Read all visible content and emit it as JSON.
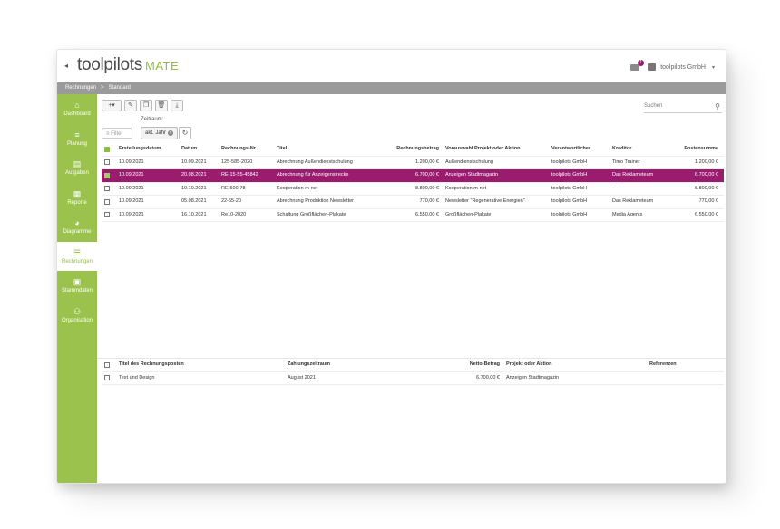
{
  "app": {
    "logo_main": "toolpilots",
    "logo_suffix": "MATE",
    "back_glyph": "◂"
  },
  "header": {
    "mail_badge": "1",
    "account": "toolpilots GmbH",
    "caret": "▾"
  },
  "breadcrumb": {
    "items": [
      "Rechnungen",
      "Standard"
    ],
    "separator": ">"
  },
  "sidebar": {
    "items": [
      {
        "label": "Dashboard",
        "icon": "home-icon",
        "glyph": "⌂"
      },
      {
        "label": "Planung",
        "icon": "planning-icon",
        "glyph": "≡"
      },
      {
        "label": "Aufgaben",
        "icon": "tasks-icon",
        "glyph": "▤"
      },
      {
        "label": "Reporte",
        "icon": "report-icon",
        "glyph": "▦"
      },
      {
        "label": "Diagramme",
        "icon": "pie-chart-icon",
        "glyph": "◕"
      },
      {
        "label": "Rechnungen",
        "icon": "invoice-icon",
        "glyph": "☰",
        "active": true
      },
      {
        "label": "Stammdaten",
        "icon": "image-icon",
        "glyph": "▣"
      },
      {
        "label": "Organisation",
        "icon": "organisation-icon",
        "glyph": "⚇"
      }
    ]
  },
  "toolbar": {
    "add": "+▾",
    "edit": "✎",
    "copy": "❐",
    "delete": "🗑",
    "download": "⤓"
  },
  "filter": {
    "placeholder": "Filter",
    "zeitraum_label": "Zeitraum:",
    "chip": "akt. Jahr",
    "chip_remove": "×",
    "refresh": "↻"
  },
  "search": {
    "placeholder": "Suchen",
    "glyph": "⚲"
  },
  "invoices": {
    "headers": [
      "Erstellungsdatum",
      "Datum",
      "Rechnungs-Nr.",
      "Titel",
      "Rechnungsbetrag",
      "Vorauswahl Projekt oder Aktion",
      "Verantwortlicher",
      "Kreditor",
      "Postensumme"
    ],
    "rows": [
      [
        "10.09.2021",
        "10.09.2021",
        "125-585-2020",
        "Abrechnung Außendienstschulung",
        "1.200,00 €",
        "Außendienstschulung",
        "toolpilots GmbH",
        "Timo Trainer",
        "1.200,00 €"
      ],
      [
        "10.09.2021",
        "20.08.2021",
        "RE-15-55-45842",
        "Abrechnung für Anzeigenstrecke",
        "6.700,00 €",
        "Anzeigen Stadtmagazin",
        "toolpilots GmbH",
        "Das Reklameteam",
        "6.700,00 €"
      ],
      [
        "10.09.2021",
        "10.10.2021",
        "RE-500-78",
        "Kooperation m-net",
        "8.800,00 €",
        "Kooperation m-net",
        "toolpilots GmbH",
        "—",
        "8.800,00 €"
      ],
      [
        "10.09.2021",
        "05.08.2021",
        "22-55-20",
        "Abrechnung Produktion Newsletter",
        "770,00 €",
        "Newsletter \"Regenerative Energien\"",
        "toolpilots GmbH",
        "Das Reklameteam",
        "770,00 €"
      ],
      [
        "10.09.2021",
        "16.10.2021",
        "Re10-2020",
        "Schaltung Großflächen-Plakate",
        "6.550,00 €",
        "Großflächen-Plakate",
        "toolpilots GmbH",
        "Media Agents",
        "6.550,00 €"
      ]
    ],
    "selected_row": 1
  },
  "positions": {
    "headers": [
      "Titel des Rechnungsposten",
      "Zahlungszeitraum",
      "Netto-Betrag",
      "Projekt oder Aktion",
      "Referenzen"
    ],
    "rows": [
      [
        "Text und Design",
        "August 2021",
        "6.700,00 €",
        "Anzeigen Stadtmagazin",
        ""
      ]
    ]
  }
}
